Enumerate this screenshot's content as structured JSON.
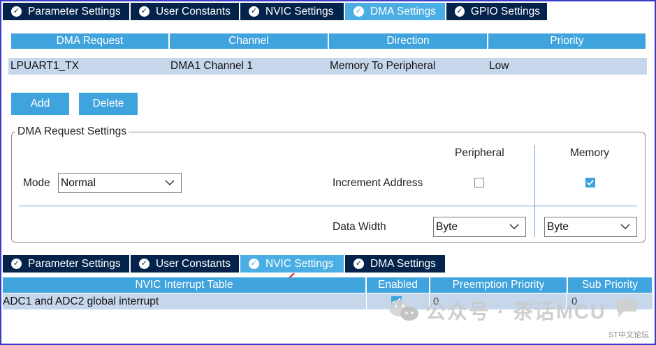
{
  "top_tabs": [
    {
      "label": "Parameter Settings",
      "active": false
    },
    {
      "label": "User Constants",
      "active": false
    },
    {
      "label": "NVIC Settings",
      "active": false
    },
    {
      "label": "DMA Settings",
      "active": true
    },
    {
      "label": "GPIO Settings",
      "active": false
    }
  ],
  "dma_table": {
    "headers": [
      "DMA Request",
      "Channel",
      "Direction",
      "Priority"
    ],
    "rows": [
      [
        "LPUART1_TX",
        "DMA1 Channel 1",
        "Memory To Peripheral",
        "Low"
      ]
    ]
  },
  "buttons": {
    "add": "Add",
    "delete": "Delete"
  },
  "dma_request_settings": {
    "title": "DMA Request Settings",
    "mode_label": "Mode",
    "mode_value": "Normal",
    "peripheral_label": "Peripheral",
    "memory_label": "Memory",
    "increment_address_label": "Increment Address",
    "peripheral_increment": false,
    "memory_increment": true,
    "data_width_label": "Data Width",
    "peripheral_data_width": "Byte",
    "memory_data_width": "Byte"
  },
  "bottom_tabs": [
    {
      "label": "Parameter Settings",
      "active": false
    },
    {
      "label": "User Constants",
      "active": false
    },
    {
      "label": "NVIC Settings",
      "active": true
    },
    {
      "label": "DMA Settings",
      "active": false
    }
  ],
  "nvic_table": {
    "headers": [
      "NVIC Interrupt Table",
      "Enabled",
      "Preemption Priority",
      "Sub Priority"
    ],
    "rows": [
      {
        "name": "ADC1 and ADC2 global interrupt",
        "enabled": true,
        "preemption": "0",
        "sub": "0"
      }
    ]
  },
  "watermark": {
    "text": "公众号 · 茶话MCU",
    "small": "ST中文论坛"
  },
  "colors": {
    "tab_dark": "#03234b",
    "accent": "#3fa3dd",
    "row": "#c6d7ec"
  }
}
